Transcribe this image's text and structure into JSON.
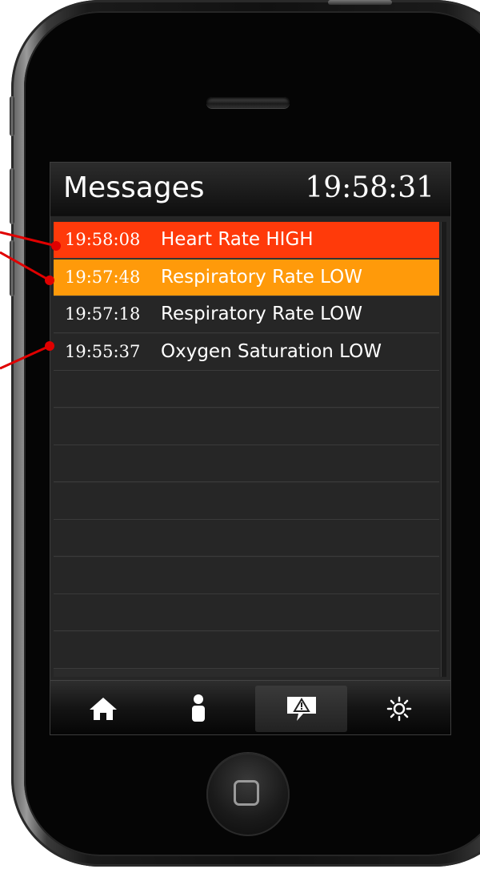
{
  "header": {
    "title": "Messages",
    "clock": "19:58:31"
  },
  "messages": [
    {
      "time": "19:58:08",
      "text": "Heart Rate HIGH",
      "background": "#ff3a0a",
      "time_color": "#ffffff",
      "text_color": "#ffffff"
    },
    {
      "time": "19:57:48",
      "text": "Respiratory Rate LOW",
      "background": "#ff9a0a",
      "time_color": "#ffffff",
      "text_color": "#ffffff"
    },
    {
      "time": "19:57:18",
      "text": "Respiratory Rate LOW",
      "background": "#262626",
      "time_color": "#ffffff",
      "text_color": "#ffffff"
    },
    {
      "time": "19:55:37",
      "text": "Oxygen Saturation LOW",
      "background": "#262626",
      "time_color": "#ffffff",
      "text_color": "#ffffff"
    }
  ],
  "empty_rows": 8,
  "tab_bar": {
    "tabs": [
      {
        "icon": "home-icon",
        "active": false
      },
      {
        "icon": "person-icon",
        "active": false
      },
      {
        "icon": "alert-message-icon",
        "active": true
      },
      {
        "icon": "settings-sun-icon",
        "active": false
      }
    ]
  },
  "colors": {
    "alarm_high": "#ff3a0a",
    "alarm_medium": "#ff9a0a",
    "callout_line": "#e00000"
  }
}
